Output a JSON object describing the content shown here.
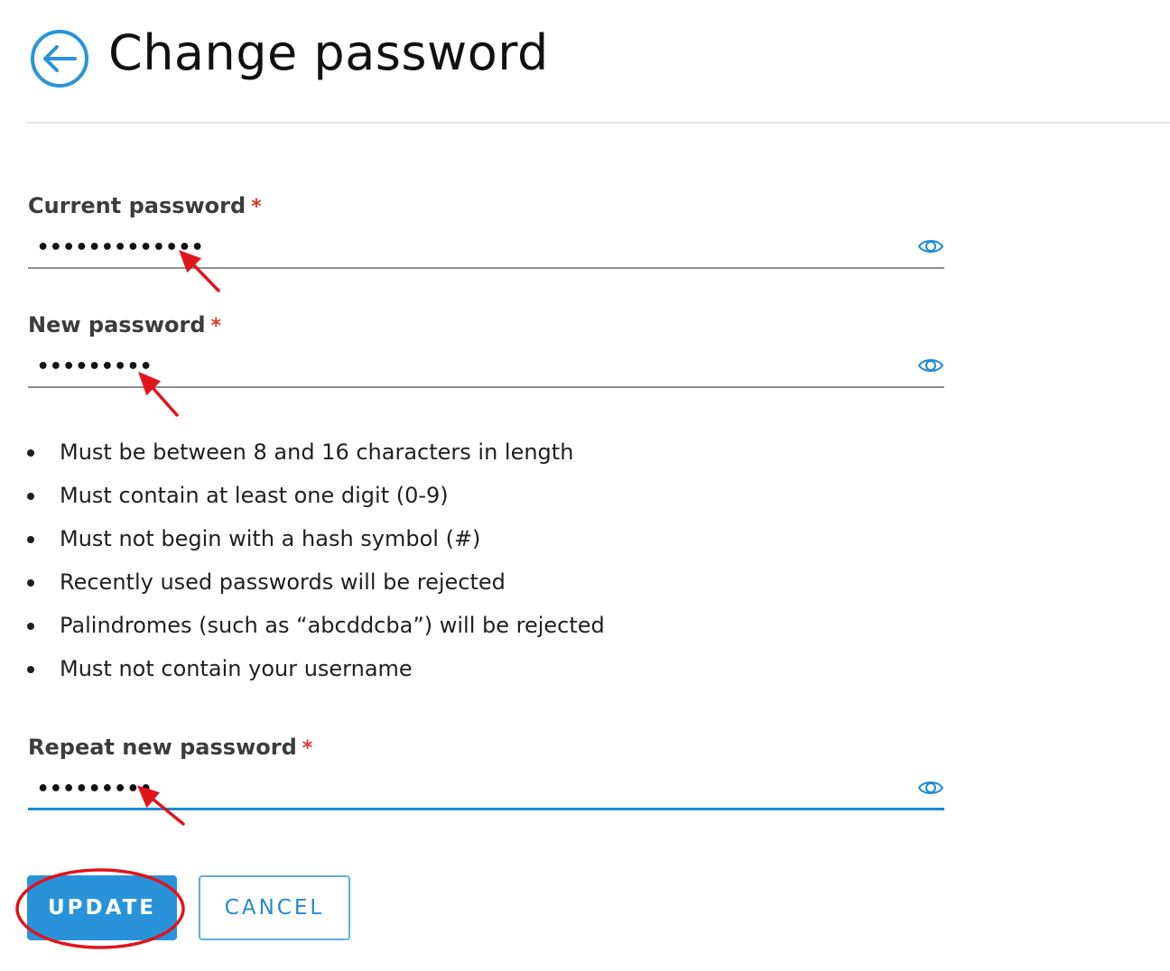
{
  "header": {
    "title": "Change password",
    "back_icon": "arrow-left-circle-icon"
  },
  "fields": {
    "current": {
      "label": "Current password",
      "required_mark": "*",
      "value": "•••••••••••••"
    },
    "new": {
      "label": "New password",
      "required_mark": "*",
      "value": "•••••••••"
    },
    "repeat": {
      "label": "Repeat new password",
      "required_mark": "*",
      "value": "•••••••••"
    },
    "reveal_icon": "eye-icon"
  },
  "rules": [
    "Must be between 8 and 16 characters in length",
    "Must contain at least one digit (0-9)",
    "Must not begin with a hash symbol (#)",
    "Recently used passwords will be rejected",
    "Palindromes (such as “abcddcba”) will be rejected",
    "Must not contain your username"
  ],
  "buttons": {
    "update": "UPDATE",
    "cancel": "CANCEL"
  },
  "colors": {
    "accent": "#2993d9",
    "required": "#d83a2b",
    "annotation": "#e0141b"
  }
}
